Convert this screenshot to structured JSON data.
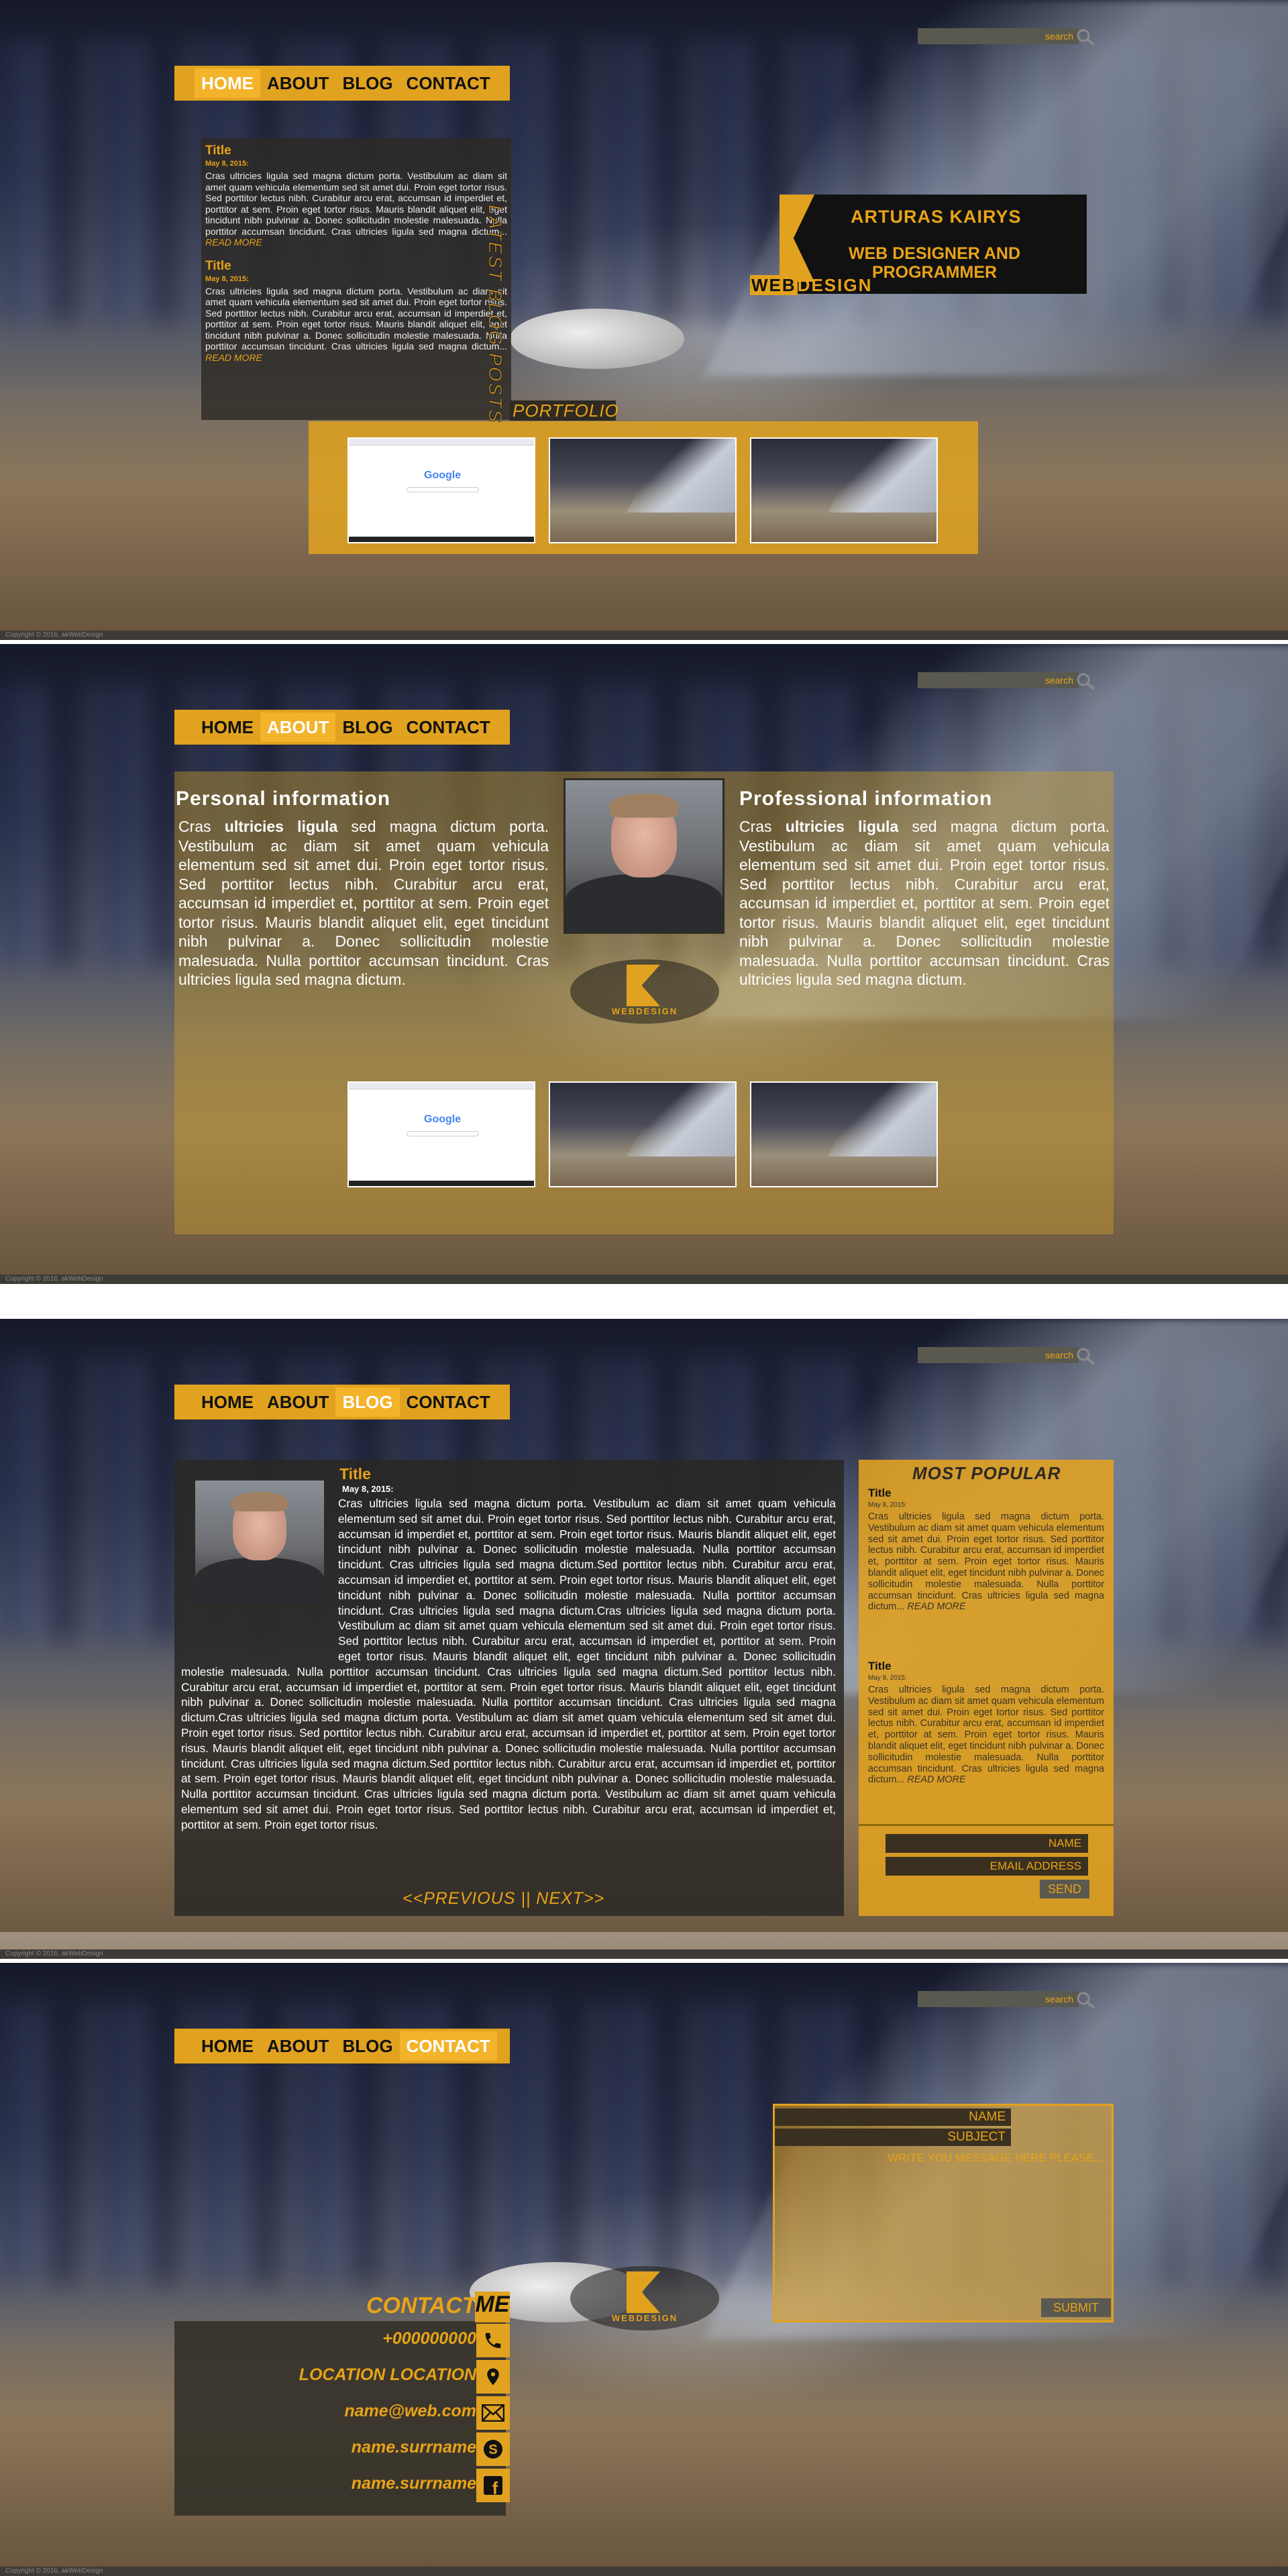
{
  "common": {
    "search_placeholder": "search",
    "nav": [
      "HOME",
      "ABOUT",
      "BLOG",
      "CONTACT"
    ],
    "copyright": "Copyright © 2016, akWebDesign",
    "logo_text": "WEBDESIGN"
  },
  "home": {
    "posts": [
      {
        "title": "Title",
        "date": "May 8, 2015:",
        "text": "Cras ultricies ligula sed magna dictum porta. Vestibulum ac diam sit amet quam vehicula elementum sed sit amet dui. Proin eget tortor risus. Sed porttitor lectus nibh. Curabitur arcu erat, accumsan id imperdiet et, porttitor at sem. Proin eget tortor risus. Mauris blandit aliquet elit, eget tincidunt nibh pulvinar a. Donec sollicitudin molestie malesuada. Nulla porttitor accumsan tincidunt. Cras ultricies ligula sed magna dictum...",
        "read_more": "READ MORE"
      },
      {
        "title": "Title",
        "date": "May 8, 2015:",
        "text": "Cras ultricies ligula sed magna dictum porta. Vestibulum ac diam sit amet quam vehicula elementum sed sit amet dui. Proin eget tortor risus. Sed porttitor lectus nibh. Curabitur arcu erat, accumsan id imperdiet et, porttitor at sem. Proin eget tortor risus. Mauris blandit aliquet elit, eget tincidunt nibh pulvinar a. Donec sollicitudin molestie malesuada. Nulla porttitor accumsan tincidunt. Cras ultricies ligula sed magna dictum...",
        "read_more": "READ MORE"
      }
    ],
    "latest_blog_label": "LATEST BLOG POSTS",
    "portfolio_label": "PORTFOLIO",
    "brand_name": "ARTURAS KAIRYS",
    "brand_job": "WEB DESIGNER AND PROGRAMMER",
    "brand_wd_web": "WEB",
    "brand_wd_design": "DESIGN",
    "google_logo": "Google"
  },
  "about": {
    "personal_heading": "Personal information",
    "professional_heading": "Professional information",
    "lead": "Cras ",
    "bold": "ultricies ligula",
    "personal_text": " sed magna dictum porta. Vestibulum ac diam sit amet quam vehicula elementum sed sit amet dui. Proin eget tortor risus. Sed porttitor lectus nibh. Curabitur arcu erat, accumsan id imperdiet et, porttitor at sem. Proin eget tortor risus. Mauris blandit aliquet elit, eget tincidunt nibh pulvinar a. Donec sollicitudin molestie malesuada. Nulla porttitor accumsan tincidunt. Cras ultricies ligula sed magna dictum.",
    "professional_text": " sed magna dictum porta. Vestibulum ac diam sit amet quam vehicula elementum sed sit amet dui. Proin eget tortor risus. Sed porttitor lectus nibh. Curabitur arcu erat, accumsan id imperdiet et, porttitor at sem. Proin eget tortor risus. Mauris blandit aliquet elit, eget tincidunt nibh pulvinar a. Donec sollicitudin molestie malesuada. Nulla porttitor accumsan tincidunt. Cras ultricies ligula sed magna dictum."
  },
  "blog": {
    "title": "Title",
    "date": "May 8, 2015:",
    "text": "Cras ultricies ligula sed magna dictum porta. Vestibulum ac diam sit amet quam vehicula elementum sed sit amet dui. Proin eget tortor risus. Sed porttitor lectus nibh. Curabitur arcu erat, accumsan id imperdiet et, porttitor at sem. Proin eget tortor risus. Mauris blandit aliquet elit, eget tincidunt nibh pulvinar a. Donec sollicitudin molestie malesuada. Nulla porttitor accumsan tincidunt. Cras ultricies ligula sed magna dictum.Sed porttitor lectus nibh. Curabitur arcu erat, accumsan id imperdiet et, porttitor at sem. Proin eget tortor risus. Mauris blandit aliquet elit, eget tincidunt nibh pulvinar a. Donec sollicitudin molestie malesuada. Nulla porttitor accumsan tincidunt. Cras ultricies ligula sed magna dictum.Cras ultricies ligula sed magna dictum porta. Vestibulum ac diam sit amet quam vehicula elementum sed sit amet dui. Proin eget tortor risus. Sed porttitor lectus nibh. Curabitur arcu erat, accumsan id imperdiet et, porttitor at sem. Proin eget tortor risus. Mauris blandit aliquet elit, eget tincidunt nibh pulvinar a. Donec sollicitudin molestie malesuada. Nulla porttitor accumsan tincidunt. Cras ultricies ligula sed magna dictum.Sed porttitor lectus nibh. Curabitur arcu erat, accumsan id imperdiet et, porttitor at sem. Proin eget tortor risus. Mauris blandit aliquet elit, eget tincidunt nibh pulvinar a. Donec sollicitudin molestie malesuada. Nulla porttitor accumsan tincidunt. Cras ultricies ligula sed magna dictum.Cras ultricies ligula sed magna dictum porta. Vestibulum ac diam sit amet quam vehicula elementum sed sit amet dui. Proin eget tortor risus. Sed porttitor lectus nibh. Curabitur arcu erat, accumsan id imperdiet et, porttitor at sem. Proin eget tortor risus. Mauris blandit aliquet elit, eget tincidunt nibh pulvinar a. Donec sollicitudin molestie malesuada. Nulla porttitor accumsan tincidunt. Cras ultricies ligula sed magna dictum.Sed porttitor lectus nibh. Curabitur arcu erat, accumsan id imperdiet et, porttitor at sem. Proin eget tortor risus. Mauris blandit aliquet elit, eget tincidunt nibh pulvinar a. Donec sollicitudin molestie malesuada. Nulla porttitor accumsan tincidunt. Cras ultricies ligula sed magna dictum porta. Vestibulum ac diam sit amet quam vehicula elementum sed sit amet dui. Proin eget tortor risus. Sed porttitor lectus nibh. Curabitur arcu erat, accumsan id imperdiet et, porttitor at sem. Proin eget tortor risus.",
    "pager": "<<PREVIOUS || NEXT>>",
    "most_popular": "MOST POPULAR",
    "popular_posts": [
      {
        "title": "Title",
        "date": "May 8, 2015:",
        "text": "Cras ultricies ligula sed magna dictum porta. Vestibulum ac diam sit amet quam vehicula elementum sed sit amet dui. Proin eget tortor risus. Sed porttitor lectus nibh. Curabitur arcu erat, accumsan id imperdiet et, porttitor at sem. Proin eget tortor risus. Mauris blandit aliquet elit, eget tincidunt nibh pulvinar a. Donec sollicitudin molestie malesuada. Nulla porttitor accumsan tincidunt. Cras ultricies ligula sed magna dictum...",
        "read_more": "READ MORE"
      },
      {
        "title": "Title",
        "date": "May 8, 2015:",
        "text": "Cras ultricies ligula sed magna dictum porta. Vestibulum ac diam sit amet quam vehicula elementum sed sit amet dui. Proin eget tortor risus. Sed porttitor lectus nibh. Curabitur arcu erat, accumsan id imperdiet et, porttitor at sem. Proin eget tortor risus. Mauris blandit aliquet elit, eget tincidunt nibh pulvinar a. Donec sollicitudin molestie malesuada. Nulla porttitor accumsan tincidunt. Cras ultricies ligula sed magna dictum...",
        "read_more": "READ MORE"
      }
    ],
    "name_field": "NAME",
    "email_field": "EMAIL ADDRESS",
    "send": "SEND"
  },
  "contact": {
    "heading": "CONTACT",
    "me": "ME",
    "phone": "+000000000",
    "location": "LOCATION LOCATION",
    "email": "name@web.com",
    "skype": "name.surrname",
    "facebook": "name.surrname",
    "name_field": "NAME",
    "subject_field": "SUBJECT",
    "message_placeholder": "WRITE YOU MESSAGE HERE PLEASE...",
    "submit": "SUBMIT"
  },
  "colors": {
    "accent": "#e1a21f",
    "dark": "#2d2a24",
    "search_bg": "#5a5950"
  }
}
